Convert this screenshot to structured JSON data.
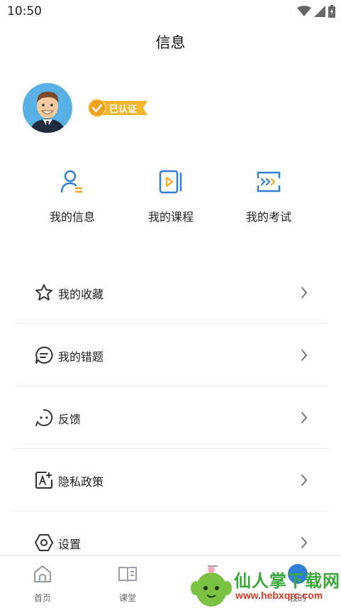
{
  "status_bar": {
    "time": "10:50"
  },
  "header": {
    "title": "信息"
  },
  "profile": {
    "badge": "已认证"
  },
  "quick_actions": [
    {
      "label": "我的信息",
      "icon": "user-info-icon"
    },
    {
      "label": "我的课程",
      "icon": "course-play-icon"
    },
    {
      "label": "我的考试",
      "icon": "exam-forward-icon"
    }
  ],
  "menu": [
    {
      "label": "我的收藏",
      "icon": "star-icon"
    },
    {
      "label": "我的错题",
      "icon": "chat-bubble-icon"
    },
    {
      "label": "反馈",
      "icon": "feedback-face-icon"
    },
    {
      "label": "隐私政策",
      "icon": "privacy-edit-icon"
    },
    {
      "label": "设置",
      "icon": "settings-hex-icon"
    }
  ],
  "tab_bar": {
    "tabs": [
      {
        "label": "首页",
        "icon": "home-icon"
      },
      {
        "label": "课堂",
        "icon": "book-icon"
      },
      {
        "label": "",
        "icon": "download-icon"
      },
      {
        "label": "我的",
        "icon": "profile-icon"
      }
    ]
  },
  "watermark": {
    "text": "仙人掌下载网",
    "url": "www.hebxqrc.com"
  },
  "colors": {
    "accent": "#2f7fd6",
    "badge": "#f5b62e",
    "watermark_green": "#39a83a"
  }
}
